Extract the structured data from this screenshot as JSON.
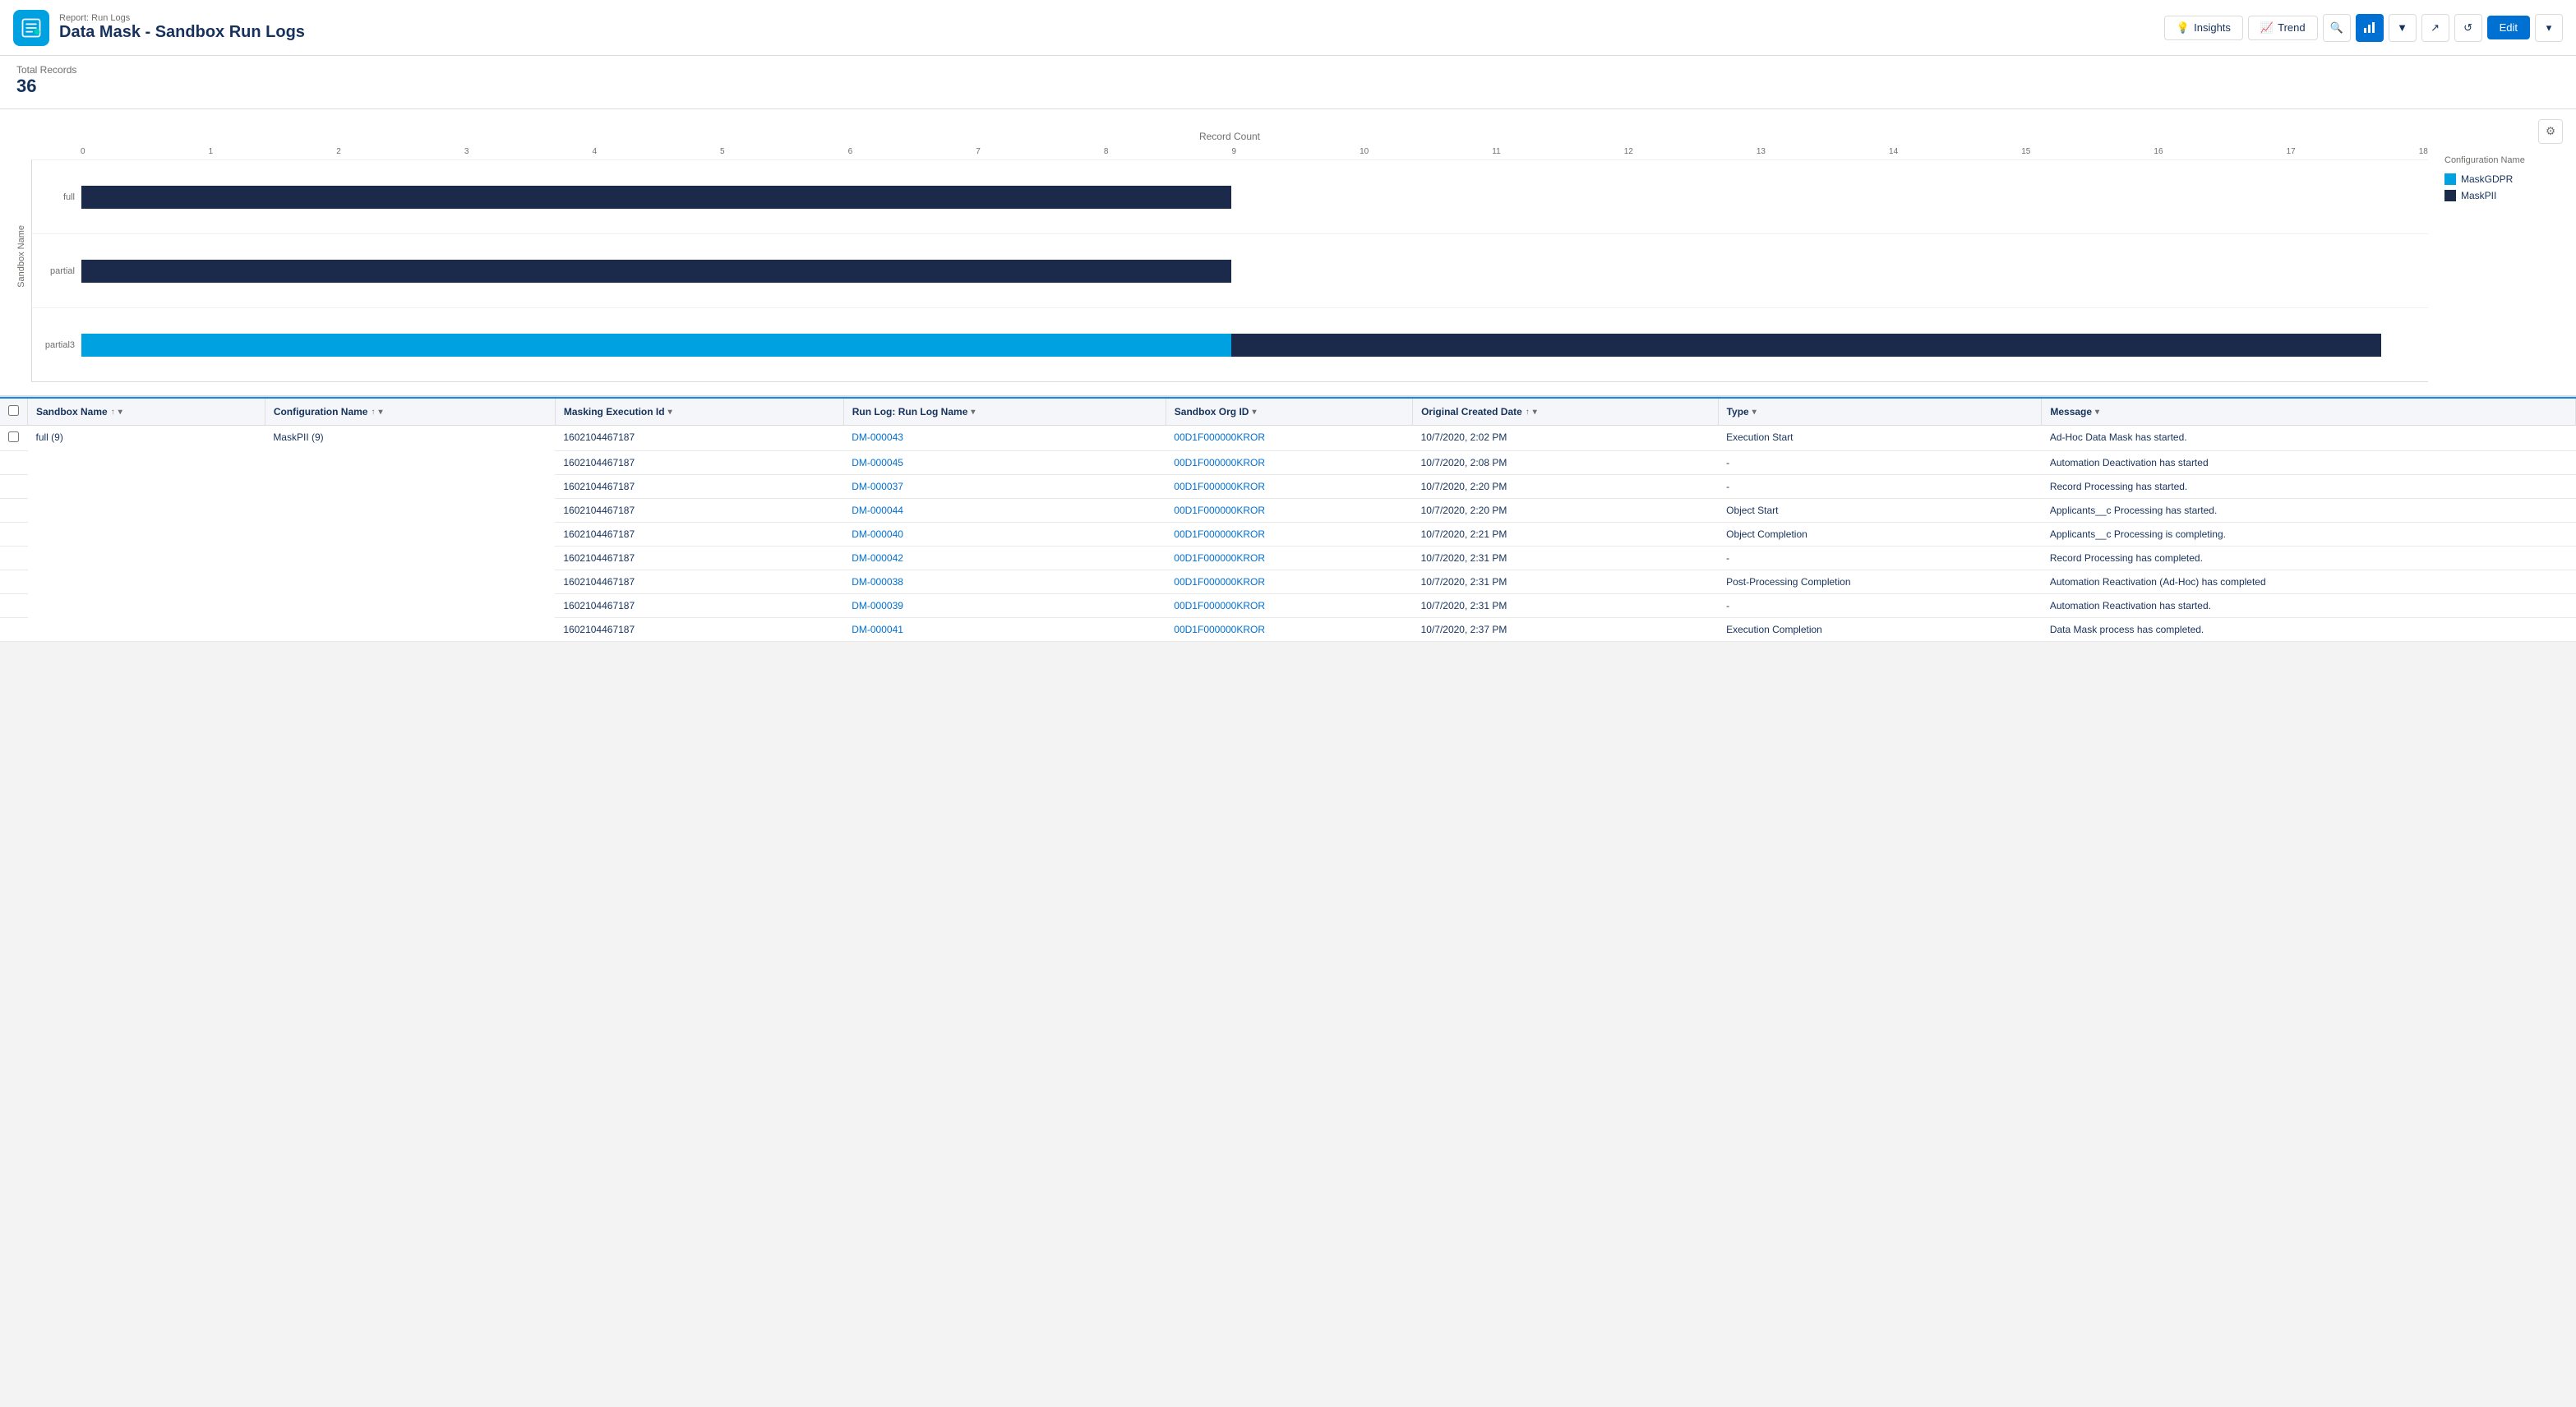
{
  "header": {
    "subtitle": "Report: Run Logs",
    "title": "Data Mask - Sandbox Run Logs",
    "app_icon_label": "data-mask-icon",
    "buttons": {
      "insights": "Insights",
      "trend": "Trend",
      "edit": "Edit"
    }
  },
  "summary": {
    "label": "Total Records",
    "value": "36"
  },
  "chart": {
    "title": "Record Count",
    "y_axis_label": "Sandbox Name",
    "x_axis": [
      "0",
      "1",
      "2",
      "3",
      "4",
      "5",
      "6",
      "7",
      "8",
      "9",
      "10",
      "11",
      "12",
      "13",
      "14",
      "15",
      "16",
      "17",
      "18"
    ],
    "legend_title": "Configuration Name",
    "legend": [
      {
        "label": "MaskGDPR",
        "color": "#00a1e0"
      },
      {
        "label": "MaskPII",
        "color": "#1b2a4a"
      }
    ],
    "rows": [
      {
        "label": "full",
        "bars": [
          {
            "type": "dark",
            "width_pct": 49,
            "value": 9
          }
        ]
      },
      {
        "label": "partial",
        "bars": [
          {
            "type": "dark",
            "width_pct": 49,
            "value": 9
          }
        ]
      },
      {
        "label": "partial3",
        "bars": [
          {
            "type": "blue",
            "width_pct": 49,
            "value": 9
          },
          {
            "type": "dark",
            "width_pct": 49,
            "value": 9
          }
        ]
      }
    ]
  },
  "table": {
    "columns": [
      {
        "key": "sandbox_name",
        "label": "Sandbox Name",
        "sortable": true,
        "filterable": true
      },
      {
        "key": "config_name",
        "label": "Configuration Name",
        "sortable": true,
        "filterable": true
      },
      {
        "key": "exec_id",
        "label": "Masking Execution Id",
        "sortable": false,
        "filterable": true
      },
      {
        "key": "run_log_name",
        "label": "Run Log: Run Log Name",
        "sortable": false,
        "filterable": true
      },
      {
        "key": "sandbox_org_id",
        "label": "Sandbox Org ID",
        "sortable": false,
        "filterable": true
      },
      {
        "key": "created_date",
        "label": "Original Created Date",
        "sortable": true,
        "filterable": true
      },
      {
        "key": "type",
        "label": "Type",
        "sortable": false,
        "filterable": true
      },
      {
        "key": "message",
        "label": "Message",
        "sortable": false,
        "filterable": true
      }
    ],
    "groups": [
      {
        "sandbox_name": "full (9)",
        "config_name": "MaskPII (9)",
        "rows": [
          {
            "exec_id": "1602104467187",
            "run_log_name": "DM-000043",
            "sandbox_org_id": "00D1F000000KROR",
            "created_date": "10/7/2020, 2:02 PM",
            "type": "Execution Start",
            "message": "Ad-Hoc Data Mask has started."
          },
          {
            "exec_id": "1602104467187",
            "run_log_name": "DM-000045",
            "sandbox_org_id": "00D1F000000KROR",
            "created_date": "10/7/2020, 2:08 PM",
            "type": "-",
            "message": "Automation Deactivation has started"
          },
          {
            "exec_id": "1602104467187",
            "run_log_name": "DM-000037",
            "sandbox_org_id": "00D1F000000KROR",
            "created_date": "10/7/2020, 2:20 PM",
            "type": "-",
            "message": "Record Processing has started."
          },
          {
            "exec_id": "1602104467187",
            "run_log_name": "DM-000044",
            "sandbox_org_id": "00D1F000000KROR",
            "created_date": "10/7/2020, 2:20 PM",
            "type": "Object Start",
            "message": "Applicants__c Processing has started."
          },
          {
            "exec_id": "1602104467187",
            "run_log_name": "DM-000040",
            "sandbox_org_id": "00D1F000000KROR",
            "created_date": "10/7/2020, 2:21 PM",
            "type": "Object Completion",
            "message": "Applicants__c Processing is completing."
          },
          {
            "exec_id": "1602104467187",
            "run_log_name": "DM-000042",
            "sandbox_org_id": "00D1F000000KROR",
            "created_date": "10/7/2020, 2:31 PM",
            "type": "-",
            "message": "Record Processing has completed."
          },
          {
            "exec_id": "1602104467187",
            "run_log_name": "DM-000038",
            "sandbox_org_id": "00D1F000000KROR",
            "created_date": "10/7/2020, 2:31 PM",
            "type": "Post-Processing Completion",
            "message": "Automation Reactivation (Ad-Hoc) has completed"
          },
          {
            "exec_id": "1602104467187",
            "run_log_name": "DM-000039",
            "sandbox_org_id": "00D1F000000KROR",
            "created_date": "10/7/2020, 2:31 PM",
            "type": "-",
            "message": "Automation Reactivation has started."
          },
          {
            "exec_id": "1602104467187",
            "run_log_name": "DM-000041",
            "sandbox_org_id": "00D1F000000KROR",
            "created_date": "10/7/2020, 2:37 PM",
            "type": "Execution Completion",
            "message": "Data Mask process has completed."
          }
        ]
      }
    ]
  }
}
